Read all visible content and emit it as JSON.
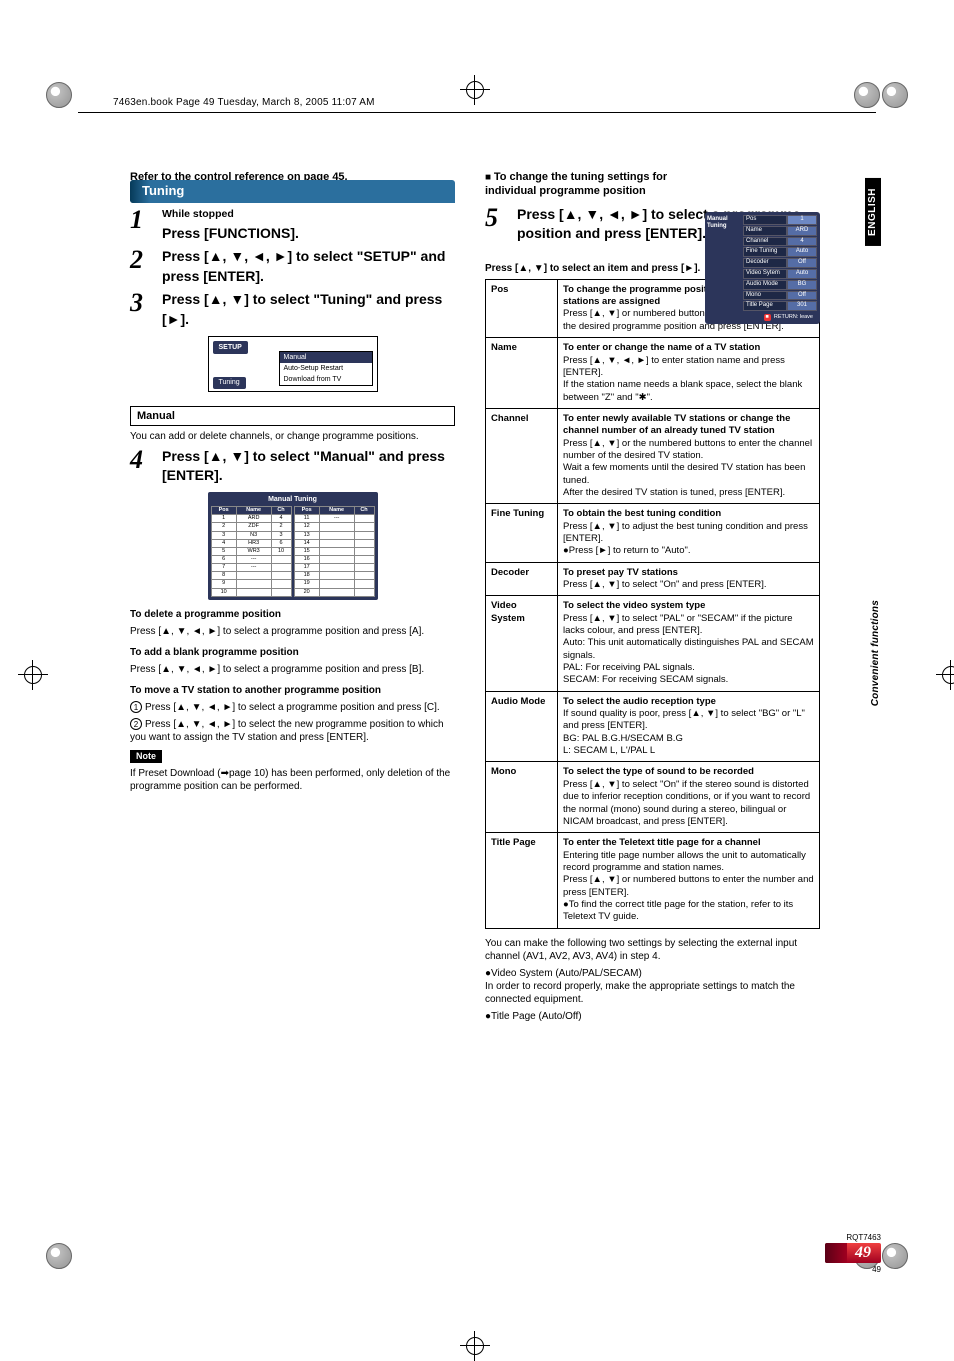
{
  "meta": {
    "bookmark": "7463en.book  Page 49  Tuesday, March 8, 2005  11:07 AM",
    "refLine": "Refer to the control reference on page 45."
  },
  "tuning": {
    "title": "Tuning",
    "step1_sub": "While stopped",
    "step1": "Press [FUNCTIONS].",
    "step2": "Press [▲, ▼, ◄, ►] to select \"SETUP\" and press [ENTER].",
    "step3": "Press [▲, ▼] to select \"Tuning\" and press [►].",
    "setupPanel": {
      "tab": "SETUP",
      "items": [
        "Manual",
        "Auto-Setup Restart",
        "Download from TV"
      ],
      "tune": "Tuning"
    },
    "manualHead": "Manual",
    "manualDesc": "You can add or delete channels, or change programme positions.",
    "step4": "Press [▲, ▼] to select \"Manual\" and press [ENTER].",
    "manualPanel": {
      "hdr": "Manual Tuning",
      "cols": [
        "Pos",
        "Name",
        "Ch"
      ],
      "rows": [
        [
          "1",
          "ARD",
          "4"
        ],
        [
          "2",
          "ZDF",
          "2"
        ],
        [
          "3",
          "N3",
          "3"
        ],
        [
          "4",
          "HR3",
          "6"
        ],
        [
          "5",
          "WR3",
          "10"
        ],
        [
          "6",
          "---",
          ""
        ],
        [
          "7",
          "---",
          ""
        ],
        [
          "8",
          "",
          ""
        ],
        [
          "9",
          "",
          ""
        ],
        [
          "10",
          "",
          ""
        ]
      ],
      "rows2": [
        [
          "11",
          "---",
          ""
        ],
        [
          "12",
          "",
          ""
        ],
        [
          "13",
          "",
          ""
        ],
        [
          "14",
          "",
          ""
        ],
        [
          "15",
          "",
          ""
        ],
        [
          "16",
          "",
          ""
        ],
        [
          "17",
          "",
          ""
        ],
        [
          "18",
          "",
          ""
        ],
        [
          "19",
          "",
          ""
        ],
        [
          "20",
          "",
          ""
        ]
      ]
    },
    "deleteHead": "To delete a programme position",
    "deleteTxt": "Press [▲, ▼, ◄, ►] to select a programme position and press [A].",
    "addHead": "To add a blank programme position",
    "addTxt": "Press [▲, ▼, ◄, ►] to select a programme position and press [B].",
    "moveHead": "To move a TV station to another programme position",
    "move1": "Press [▲, ▼, ◄, ►] to select a programme position and press [C].",
    "move2": "Press [▲, ▼, ◄, ►] to select the new programme position to which you want to assign the TV station and press [ENTER].",
    "noteTag": "Note",
    "note": "If Preset Download (➡page 10) has been performed, only deletion of the programme position can be performed."
  },
  "right": {
    "changeHead": "To change the tuning settings for individual programme position",
    "step5": "Press [▲, ▼, ◄, ►] to select a programme position and press [ENTER].",
    "panel": {
      "sideLabel": "Manual Tuning",
      "rows": [
        {
          "l": "Pos",
          "v": "1"
        },
        {
          "l": "Name",
          "v": "ARD"
        },
        {
          "l": "Channel",
          "v": "4"
        },
        {
          "l": "Fine Tuning",
          "v": "Auto"
        },
        {
          "l": "Decoder",
          "v": "Off"
        },
        {
          "l": "Video Sytem",
          "v": "Auto"
        },
        {
          "l": "Audio Mode",
          "v": "BG"
        },
        {
          "l": "Mono",
          "v": "Off"
        },
        {
          "l": "Title Page",
          "v": "301"
        }
      ],
      "return": "RETURN:  leave"
    },
    "pressSel": "Press [▲, ▼] to select an item and press [►].",
    "table": {
      "pos": [
        "Pos",
        "To change the programme position in which the TV stations are assigned\nPress [▲, ▼] or numbered buttons to select the number of the desired programme position and press [ENTER]."
      ],
      "name": [
        "Name",
        "To enter or change the name of a TV station\nPress [▲, ▼, ◄, ►] to enter station name and press [ENTER].\nIf the station name needs a blank space, select the blank between \"Z\" and \"✱\"."
      ],
      "channel": [
        "Channel",
        "To enter newly available TV stations or change the channel number of an already tuned TV station\nPress [▲, ▼] or the numbered buttons to enter the channel number of the desired TV station.\nWait a few moments until the desired TV station has been tuned.\nAfter the desired TV station is tuned, press [ENTER]."
      ],
      "fine": [
        "Fine Tuning",
        "To obtain the best tuning condition\nPress [▲, ▼] to adjust the best tuning condition and press [ENTER].\n●Press [►] to return to \"Auto\"."
      ],
      "decoder": [
        "Decoder",
        "To preset pay TV stations\nPress [▲, ▼] to select \"On\" and press [ENTER]."
      ],
      "video": [
        "Video System",
        "To select the video system type\nPress [▲, ▼] to select \"PAL\" or \"SECAM\" if the picture lacks colour, and press [ENTER].\nAuto:     This unit automatically distinguishes PAL and SECAM signals.\nPAL:      For receiving PAL signals.\nSECAM: For receiving SECAM signals."
      ],
      "audio": [
        "Audio Mode",
        "To select the audio reception type\nIf sound quality is poor, press [▲, ▼] to select \"BG\" or \"L\" and press [ENTER].\nBG: PAL B.G.H/SECAM B.G\nL:    SECAM L, L'/PAL L"
      ],
      "mono": [
        "Mono",
        "To select the type of sound to be recorded\nPress [▲, ▼] to select \"On\" if the stereo sound is distorted due to inferior reception conditions, or if you want to record the normal (mono) sound during a stereo, bilingual or NICAM broadcast, and press [ENTER]."
      ],
      "title": [
        "Title Page",
        "To enter the Teletext title page for a channel\nEntering title page number allows the unit to automatically record programme and station names.\nPress [▲, ▼] or numbered buttons to enter the number and press [ENTER].\n●To find the correct title page for the station, refer to its Teletext TV guide."
      ]
    },
    "tail": "You can make the following two settings by selecting the external input channel (AV1, AV2, AV3, AV4) in step 4.",
    "tail1": "●Video System (Auto/PAL/SECAM)\n   In order to record properly, make the appropriate settings to match the connected equipment.",
    "tail2": "●Title Page (Auto/Off)"
  },
  "side": {
    "english": "ENGLISH",
    "conv": "Convenient functions"
  },
  "foot": {
    "rqt": "RQT7463",
    "big": "49",
    "small": "49"
  }
}
